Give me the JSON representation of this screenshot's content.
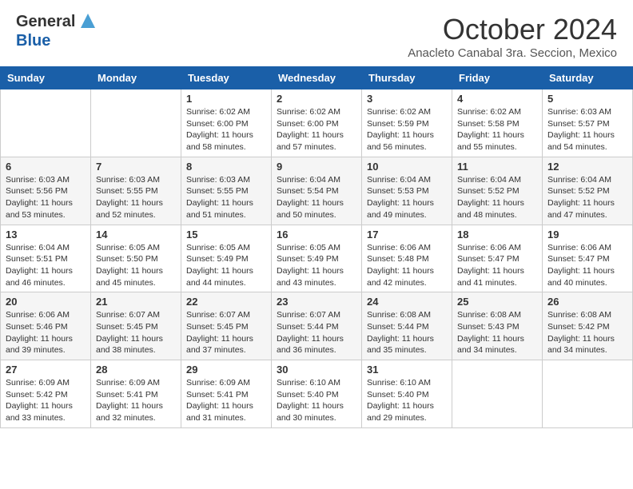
{
  "header": {
    "logo_line1": "General",
    "logo_line2": "Blue",
    "month": "October 2024",
    "location": "Anacleto Canabal 3ra. Seccion, Mexico"
  },
  "days_of_week": [
    "Sunday",
    "Monday",
    "Tuesday",
    "Wednesday",
    "Thursday",
    "Friday",
    "Saturday"
  ],
  "weeks": [
    [
      {
        "day": "",
        "info": ""
      },
      {
        "day": "",
        "info": ""
      },
      {
        "day": "1",
        "info": "Sunrise: 6:02 AM\nSunset: 6:00 PM\nDaylight: 11 hours and 58 minutes."
      },
      {
        "day": "2",
        "info": "Sunrise: 6:02 AM\nSunset: 6:00 PM\nDaylight: 11 hours and 57 minutes."
      },
      {
        "day": "3",
        "info": "Sunrise: 6:02 AM\nSunset: 5:59 PM\nDaylight: 11 hours and 56 minutes."
      },
      {
        "day": "4",
        "info": "Sunrise: 6:02 AM\nSunset: 5:58 PM\nDaylight: 11 hours and 55 minutes."
      },
      {
        "day": "5",
        "info": "Sunrise: 6:03 AM\nSunset: 5:57 PM\nDaylight: 11 hours and 54 minutes."
      }
    ],
    [
      {
        "day": "6",
        "info": "Sunrise: 6:03 AM\nSunset: 5:56 PM\nDaylight: 11 hours and 53 minutes."
      },
      {
        "day": "7",
        "info": "Sunrise: 6:03 AM\nSunset: 5:55 PM\nDaylight: 11 hours and 52 minutes."
      },
      {
        "day": "8",
        "info": "Sunrise: 6:03 AM\nSunset: 5:55 PM\nDaylight: 11 hours and 51 minutes."
      },
      {
        "day": "9",
        "info": "Sunrise: 6:04 AM\nSunset: 5:54 PM\nDaylight: 11 hours and 50 minutes."
      },
      {
        "day": "10",
        "info": "Sunrise: 6:04 AM\nSunset: 5:53 PM\nDaylight: 11 hours and 49 minutes."
      },
      {
        "day": "11",
        "info": "Sunrise: 6:04 AM\nSunset: 5:52 PM\nDaylight: 11 hours and 48 minutes."
      },
      {
        "day": "12",
        "info": "Sunrise: 6:04 AM\nSunset: 5:52 PM\nDaylight: 11 hours and 47 minutes."
      }
    ],
    [
      {
        "day": "13",
        "info": "Sunrise: 6:04 AM\nSunset: 5:51 PM\nDaylight: 11 hours and 46 minutes."
      },
      {
        "day": "14",
        "info": "Sunrise: 6:05 AM\nSunset: 5:50 PM\nDaylight: 11 hours and 45 minutes."
      },
      {
        "day": "15",
        "info": "Sunrise: 6:05 AM\nSunset: 5:49 PM\nDaylight: 11 hours and 44 minutes."
      },
      {
        "day": "16",
        "info": "Sunrise: 6:05 AM\nSunset: 5:49 PM\nDaylight: 11 hours and 43 minutes."
      },
      {
        "day": "17",
        "info": "Sunrise: 6:06 AM\nSunset: 5:48 PM\nDaylight: 11 hours and 42 minutes."
      },
      {
        "day": "18",
        "info": "Sunrise: 6:06 AM\nSunset: 5:47 PM\nDaylight: 11 hours and 41 minutes."
      },
      {
        "day": "19",
        "info": "Sunrise: 6:06 AM\nSunset: 5:47 PM\nDaylight: 11 hours and 40 minutes."
      }
    ],
    [
      {
        "day": "20",
        "info": "Sunrise: 6:06 AM\nSunset: 5:46 PM\nDaylight: 11 hours and 39 minutes."
      },
      {
        "day": "21",
        "info": "Sunrise: 6:07 AM\nSunset: 5:45 PM\nDaylight: 11 hours and 38 minutes."
      },
      {
        "day": "22",
        "info": "Sunrise: 6:07 AM\nSunset: 5:45 PM\nDaylight: 11 hours and 37 minutes."
      },
      {
        "day": "23",
        "info": "Sunrise: 6:07 AM\nSunset: 5:44 PM\nDaylight: 11 hours and 36 minutes."
      },
      {
        "day": "24",
        "info": "Sunrise: 6:08 AM\nSunset: 5:44 PM\nDaylight: 11 hours and 35 minutes."
      },
      {
        "day": "25",
        "info": "Sunrise: 6:08 AM\nSunset: 5:43 PM\nDaylight: 11 hours and 34 minutes."
      },
      {
        "day": "26",
        "info": "Sunrise: 6:08 AM\nSunset: 5:42 PM\nDaylight: 11 hours and 34 minutes."
      }
    ],
    [
      {
        "day": "27",
        "info": "Sunrise: 6:09 AM\nSunset: 5:42 PM\nDaylight: 11 hours and 33 minutes."
      },
      {
        "day": "28",
        "info": "Sunrise: 6:09 AM\nSunset: 5:41 PM\nDaylight: 11 hours and 32 minutes."
      },
      {
        "day": "29",
        "info": "Sunrise: 6:09 AM\nSunset: 5:41 PM\nDaylight: 11 hours and 31 minutes."
      },
      {
        "day": "30",
        "info": "Sunrise: 6:10 AM\nSunset: 5:40 PM\nDaylight: 11 hours and 30 minutes."
      },
      {
        "day": "31",
        "info": "Sunrise: 6:10 AM\nSunset: 5:40 PM\nDaylight: 11 hours and 29 minutes."
      },
      {
        "day": "",
        "info": ""
      },
      {
        "day": "",
        "info": ""
      }
    ]
  ]
}
